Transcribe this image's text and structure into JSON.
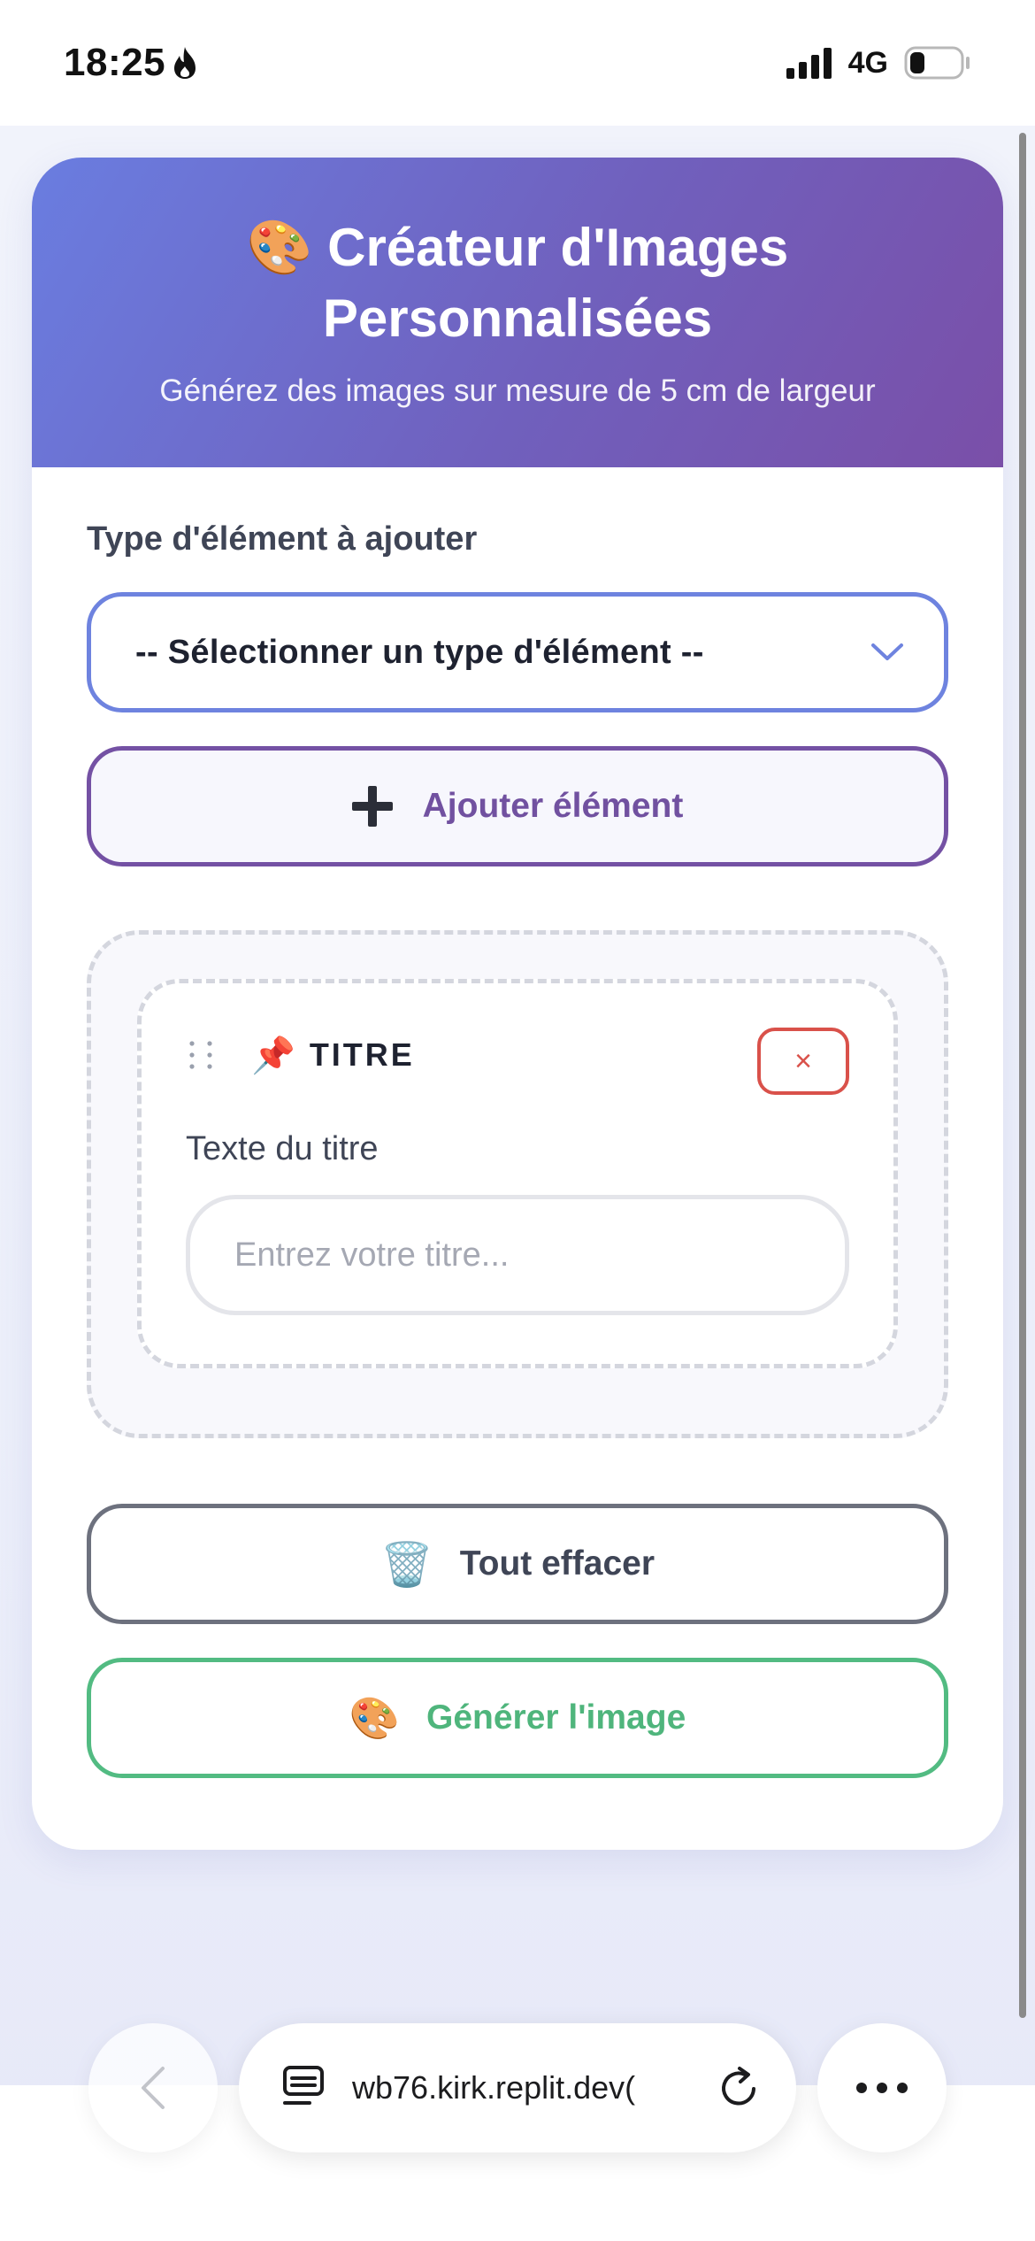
{
  "status_bar": {
    "time": "18:25",
    "network": "4G",
    "battery_level": 0.3
  },
  "header": {
    "title": "🎨 Créateur d'Images Personnalisées",
    "subtitle": "Générez des images sur mesure de 5 cm de largeur"
  },
  "element_type": {
    "label": "Type d'élément à ajouter",
    "selected": "-- Sélectionner un type d'élément --"
  },
  "add_button": {
    "label": "Ajouter élément"
  },
  "elements": [
    {
      "type_icon": "📌",
      "type_label": "TITRE",
      "remove_label": "×",
      "field_label": "Texte du titre",
      "placeholder": "Entrez votre titre..."
    }
  ],
  "clear_button": {
    "icon": "🗑️",
    "label": "Tout effacer"
  },
  "generate_button": {
    "icon": "🎨",
    "label": "Générer l'image"
  },
  "browser": {
    "url": ")wb76.kirk.replit.dev"
  },
  "colors": {
    "header_gradient_start": "#6a7de0",
    "header_gradient_end": "#7a4fa8",
    "select_border": "#6e83df",
    "add_border": "#7451a4",
    "remove_red": "#d9514a",
    "clear_border": "#6d717e",
    "generate_green": "#52bb82"
  },
  "icons": {
    "status": [
      "flame-icon",
      "signal-icon",
      "battery-icon"
    ],
    "controls": [
      "chevron-down-icon",
      "plus-icon",
      "drag-handle-icon",
      "pin-icon",
      "close-icon",
      "trash-icon",
      "palette-icon"
    ],
    "browser": [
      "back-arrow-icon",
      "tabs-icon",
      "reload-icon",
      "more-icon"
    ]
  }
}
